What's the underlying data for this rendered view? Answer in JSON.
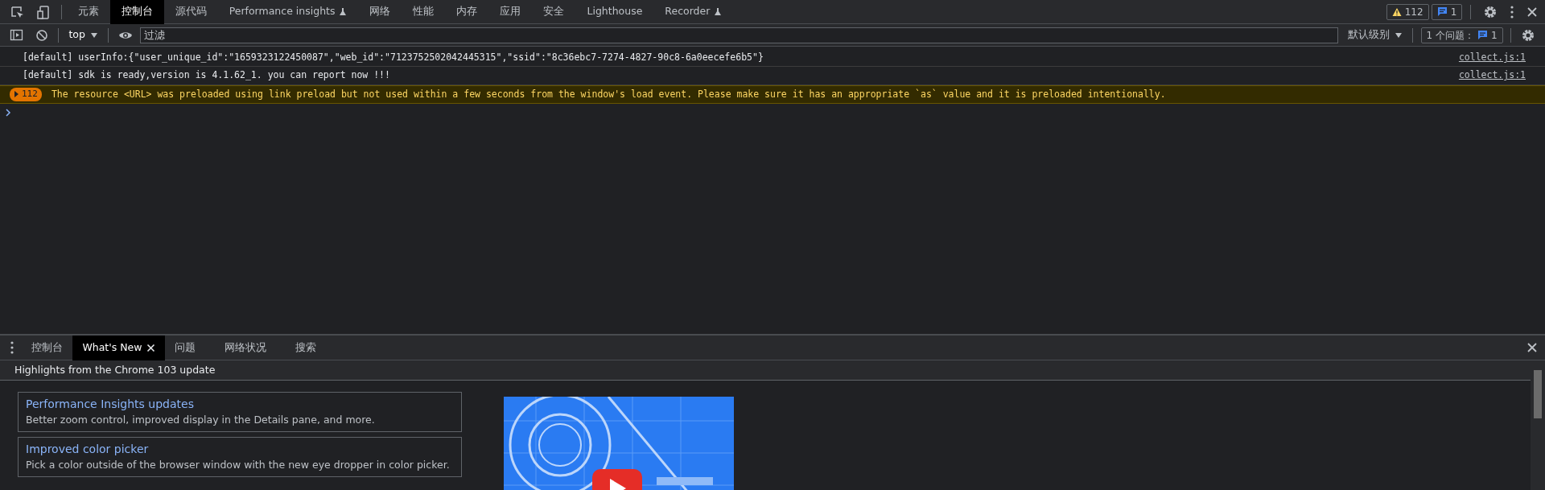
{
  "top_tabs": [
    {
      "label": "元素",
      "selected": false,
      "experimental": false
    },
    {
      "label": "控制台",
      "selected": true,
      "experimental": false
    },
    {
      "label": "源代码",
      "selected": false,
      "experimental": false
    },
    {
      "label": "Performance insights",
      "selected": false,
      "experimental": true
    },
    {
      "label": "网络",
      "selected": false,
      "experimental": false
    },
    {
      "label": "性能",
      "selected": false,
      "experimental": false
    },
    {
      "label": "内存",
      "selected": false,
      "experimental": false
    },
    {
      "label": "应用",
      "selected": false,
      "experimental": false
    },
    {
      "label": "安全",
      "selected": false,
      "experimental": false
    },
    {
      "label": "Lighthouse",
      "selected": false,
      "experimental": false
    },
    {
      "label": "Recorder",
      "selected": false,
      "experimental": true
    }
  ],
  "counters": {
    "warnings": "112",
    "messages": "1"
  },
  "console_toolbar": {
    "context": "top",
    "filter_placeholder": "过滤",
    "levels": "默认级别",
    "issues_label": "1 个问题：",
    "issues_count": "1"
  },
  "messages": [
    {
      "kind": "log",
      "text": "[default] userInfo:{\"user_unique_id\":\"1659323122450087\",\"web_id\":\"7123752502042445315\",\"ssid\":\"8c36ebc7-7274-4827-90c8-6a0eecefe6b5\"}",
      "source": "collect.js:1"
    },
    {
      "kind": "log",
      "text": "[default] sdk is ready,version is 4.1.62_1. you can report now !!!",
      "source": "collect.js:1"
    },
    {
      "kind": "warning",
      "count": "112",
      "text": "The resource <URL> was preloaded using link preload but not used within a few seconds from the window's load event. Please make sure it has an appropriate `as` value and it is preloaded intentionally."
    }
  ],
  "drawer": {
    "tabs": [
      {
        "label": "控制台",
        "selected": false,
        "closable": false
      },
      {
        "label": "What's New",
        "selected": true,
        "closable": true
      },
      {
        "label": "问题",
        "selected": false,
        "closable": false
      },
      {
        "label": "网络状况",
        "selected": false,
        "closable": false
      },
      {
        "label": "搜索",
        "selected": false,
        "closable": false
      }
    ],
    "header": "Highlights from the Chrome 103 update",
    "cards": [
      {
        "title": "Performance Insights updates",
        "description": "Better zoom control, improved display in the Details pane, and more."
      },
      {
        "title": "Improved color picker",
        "description": "Pick a color outside of the browser window with the new eye dropper in color picker."
      }
    ]
  }
}
